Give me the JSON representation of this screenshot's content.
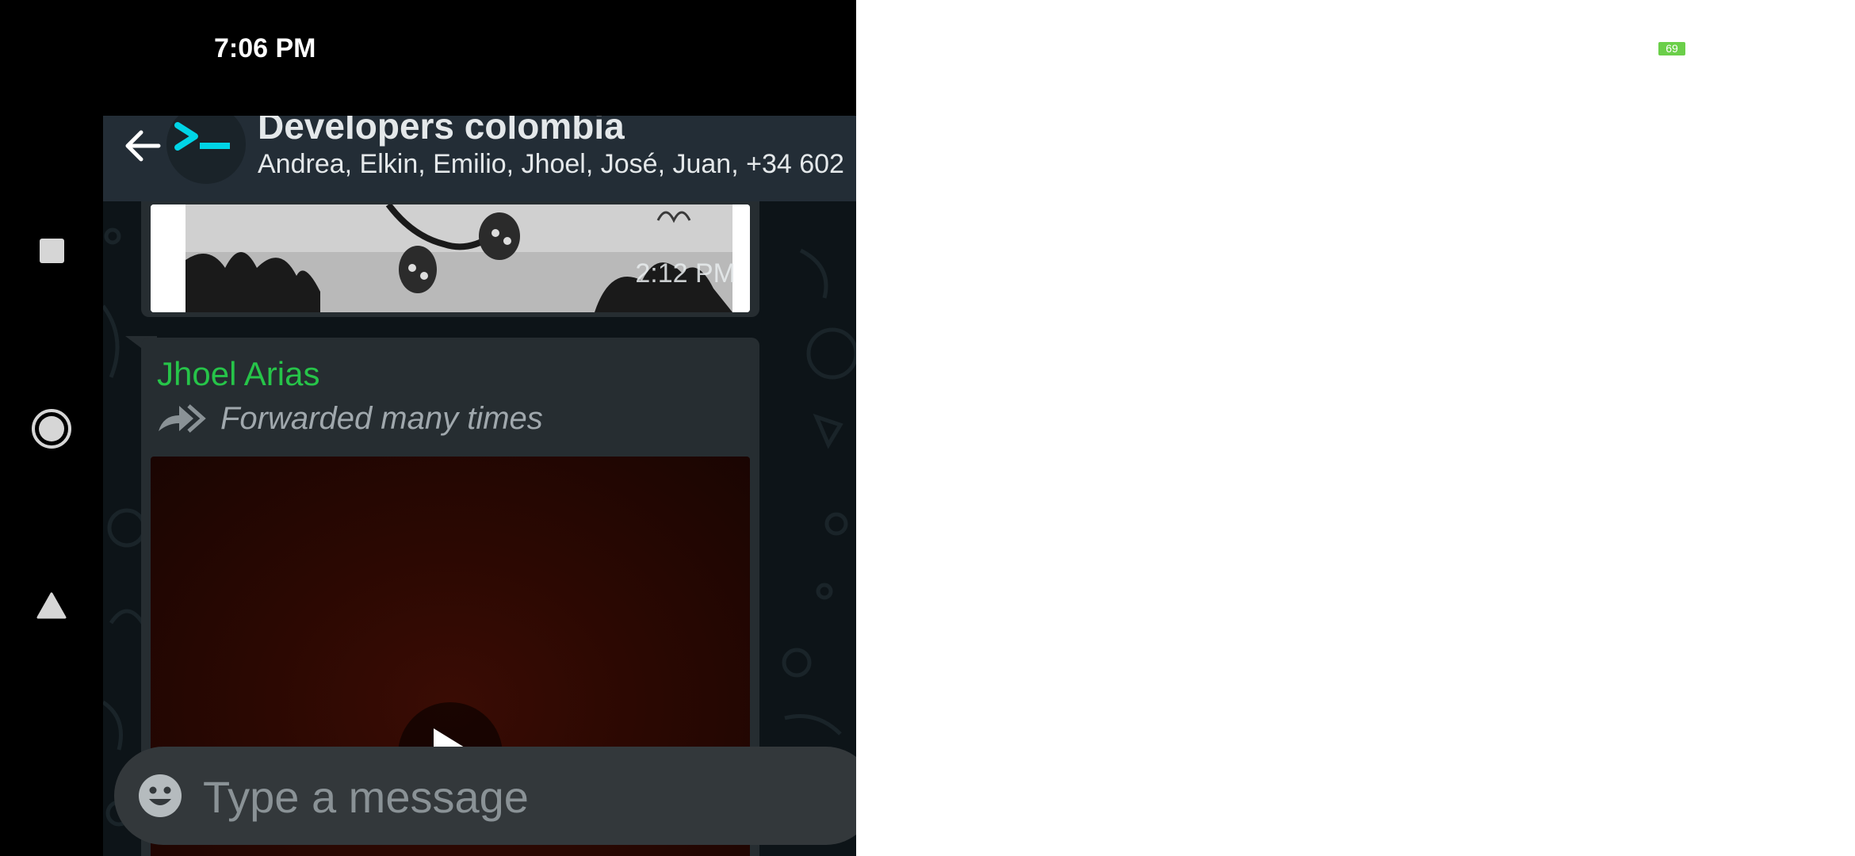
{
  "status_bar": {
    "time": "7:06 PM",
    "battery": "69"
  },
  "nav_bar": {
    "recents_icon": "square-icon",
    "home_icon": "circle-icon",
    "back_icon": "triangle-icon"
  },
  "header": {
    "title": "Developers colombia",
    "members": "Andrea, Elkin, Emilio, Jhoel, José, Juan, +34 602",
    "back_icon": "arrow-left-icon",
    "avatar_icon": "terminal-prompt-icon"
  },
  "messages": [
    {
      "type": "image",
      "time": "2:12 PM"
    },
    {
      "type": "video",
      "sender": "Jhoel Arias",
      "forwarded_label": "Forwarded many times",
      "forward_icon": "double-forward-arrow-icon",
      "play_icon": "play-icon"
    }
  ],
  "composer": {
    "placeholder": "Type a message",
    "emoji_icon": "smiley-icon"
  },
  "colors": {
    "header_bg": "#232d36",
    "chat_bg": "#0d1418",
    "bubble_bg": "#262d31",
    "sender_name": "#26c449",
    "avatar_accent": "#00d4e6",
    "battery": "#6bcf4a"
  }
}
